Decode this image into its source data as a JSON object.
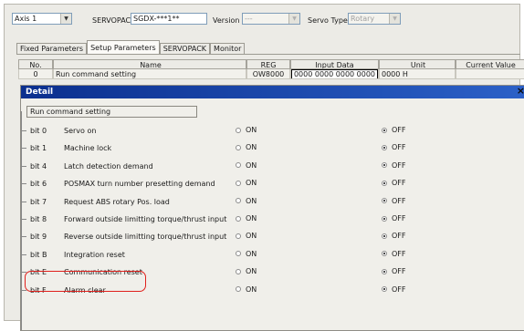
{
  "toolbar": {
    "axis": "Axis 1",
    "servopack_label": "SERVOPACK",
    "servopack_model": "SGDX-***1**",
    "version_label": "Version",
    "version_value": "---",
    "servo_type_label": "Servo Type",
    "servo_type_value": "Rotary"
  },
  "tabs": [
    {
      "label": "Fixed Parameters",
      "active": false
    },
    {
      "label": "Setup Parameters",
      "active": true
    },
    {
      "label": "SERVOPACK",
      "active": false
    },
    {
      "label": "Monitor",
      "active": false
    }
  ],
  "grid": {
    "headers": {
      "no": "No.",
      "name": "Name",
      "reg": "REG",
      "input": "Input Data",
      "unit": "Unit",
      "current": "Current Value"
    },
    "row": {
      "no": "0",
      "name": "Run command setting",
      "reg": "OW8000",
      "input": "0000 0000 0000 0000",
      "unit": "0000 H",
      "current": ""
    }
  },
  "detail": {
    "title": "Detail",
    "close": "×",
    "field": "Run command setting",
    "on_label": "ON",
    "off_label": "OFF",
    "bits": [
      {
        "bit": "bit 0",
        "desc": "Servo on",
        "value": "OFF"
      },
      {
        "bit": "bit 1",
        "desc": "Machine lock",
        "value": "OFF"
      },
      {
        "bit": "bit 4",
        "desc": "Latch detection demand",
        "value": "OFF"
      },
      {
        "bit": "bit 6",
        "desc": "POSMAX turn number presetting demand",
        "value": "OFF"
      },
      {
        "bit": "bit 7",
        "desc": "Request ABS rotary Pos. load",
        "value": "OFF"
      },
      {
        "bit": "bit 8",
        "desc": "Forward outside limitting torque/thrust input",
        "value": "OFF"
      },
      {
        "bit": "bit 9",
        "desc": "Reverse outside limitting torque/thrust input",
        "value": "OFF"
      },
      {
        "bit": "bit B",
        "desc": "Integration reset",
        "value": "OFF"
      },
      {
        "bit": "bit E",
        "desc": "Communication reset",
        "value": "OFF",
        "highlighted": true
      },
      {
        "bit": "bit F",
        "desc": "Alarm clear",
        "value": "OFF"
      }
    ]
  },
  "colors": {
    "highlight": "#e0201c",
    "titlebar": "#0b2f8e"
  }
}
